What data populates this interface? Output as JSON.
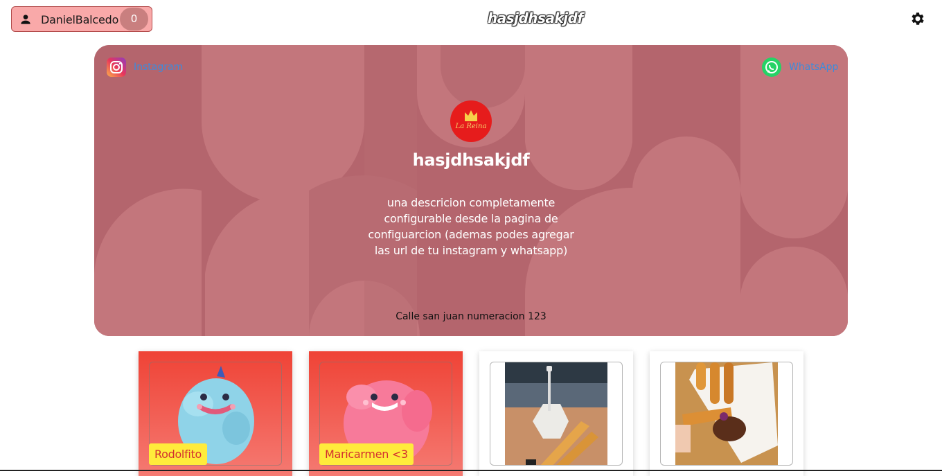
{
  "header": {
    "user_name": "DanielBalcedo",
    "cart_count": "0",
    "app_title": "hasjdhsakjdf",
    "icons": {
      "user": "person-icon",
      "settings": "gear-icon"
    }
  },
  "hero": {
    "social": {
      "instagram_label": "Instagram",
      "whatsapp_label": "WhatsApp"
    },
    "logo_text": "La Reina",
    "store_name": "hasjdhsakjdf",
    "description": "una descricion completamente configurable desde la pagina de configuarcion (ademas podes agregar las url de tu instagram y whatsapp)",
    "address": "Calle san juan numeracion 123",
    "colors": {
      "background": "#b4656d",
      "link": "#3d8bdb"
    }
  },
  "products": [
    {
      "label": "Rodolfito",
      "style": "red",
      "image": "blue-plush-monster"
    },
    {
      "label": "Maricarmen <3",
      "style": "red",
      "image": "pink-plush-monster"
    },
    {
      "label": "",
      "style": "white",
      "image": "churros-with-mate"
    },
    {
      "label": "",
      "style": "white",
      "image": "churros-with-chocolate"
    }
  ],
  "colors": {
    "tag_bg": "#ffeb3b",
    "tag_text": "#d32f2f",
    "card_red": "#ef4336"
  }
}
